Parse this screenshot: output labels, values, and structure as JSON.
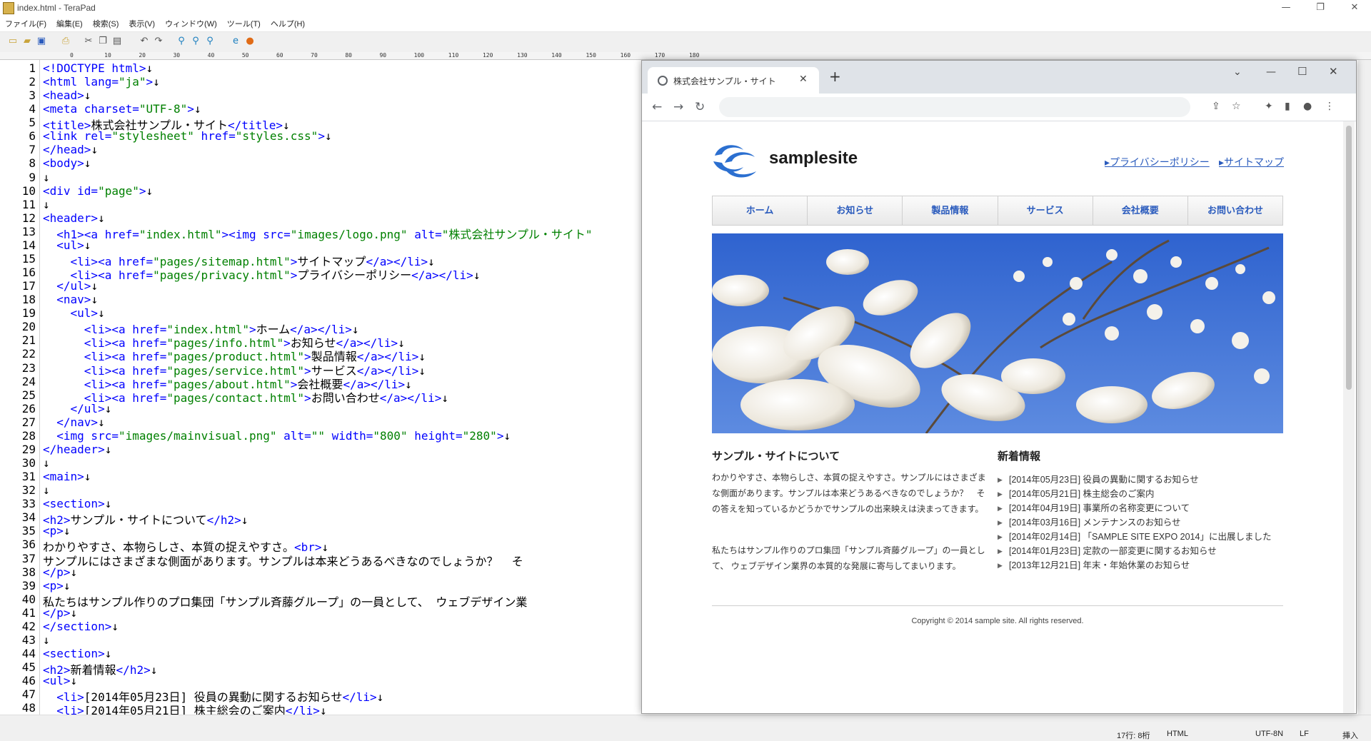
{
  "window": {
    "title": "index.html - TeraPad"
  },
  "menu": [
    "ファイル(F)",
    "編集(E)",
    "検索(S)",
    "表示(V)",
    "ウィンドウ(W)",
    "ツール(T)",
    "ヘルプ(H)"
  ],
  "ruler": {
    "marks": "0         10        20        30        40        50        60        70        80        90        100       110       120       130       140       150       160       170       180"
  },
  "editor": {
    "lines": [
      "<!DOCTYPE html>↓",
      "<html lang=\"ja\">↓",
      "<head>↓",
      "<meta charset=\"UTF-8\">↓",
      "<title>株式会社サンプル・サイト</title>↓",
      "<link rel=\"stylesheet\" href=\"styles.css\">↓",
      "</head>↓",
      "<body>↓",
      "↓",
      "<div id=\"page\">↓",
      "↓",
      "<header>↓",
      "  <h1><a href=\"index.html\"><img src=\"images/logo.png\" alt=\"株式会社サンプル・サイト\"",
      "  <ul>↓",
      "    <li><a href=\"pages/sitemap.html\">サイトマップ</a></li>↓",
      "    <li><a href=\"pages/privacy.html\">プライバシーポリシー</a></li>↓",
      "  </ul>↓",
      "  <nav>↓",
      "    <ul>↓",
      "      <li><a href=\"index.html\">ホーム</a></li>↓",
      "      <li><a href=\"pages/info.html\">お知らせ</a></li>↓",
      "      <li><a href=\"pages/product.html\">製品情報</a></li>↓",
      "      <li><a href=\"pages/service.html\">サービス</a></li>↓",
      "      <li><a href=\"pages/about.html\">会社概要</a></li>↓",
      "      <li><a href=\"pages/contact.html\">お問い合わせ</a></li>↓",
      "    </ul>↓",
      "  </nav>↓",
      "  <img src=\"images/mainvisual.png\" alt=\"\" width=\"800\" height=\"280\">↓",
      "</header>↓",
      "↓",
      "<main>↓",
      "↓",
      "<section>↓",
      "<h2>サンプル・サイトについて</h2>↓",
      "<p>↓",
      "わかりやすさ、本物らしさ、本質の捉えやすさ。<br>↓",
      "サンプルにはさまざまな側面があります。サンプルは本来どうあるべきなのでしょうか？  そ",
      "</p>↓",
      "<p>↓",
      "私たちはサンプル作りのプロ集団「サンプル斉藤グループ」の一員として、 ウェブデザイン業",
      "</p>↓",
      "</section>↓",
      "↓",
      "<section>↓",
      "<h2>新着情報</h2>↓",
      "<ul>↓",
      "  <li>[2014年05月23日] 役員の異動に関するお知らせ</li>↓",
      "  <li>[2014年05月21日] 株主総会のご案内</li>↓"
    ]
  },
  "status": {
    "position": "17行:  8桁",
    "mode": "HTML",
    "encoding": "UTF-8N",
    "linebreak": "LF",
    "insert": "挿入"
  },
  "browser": {
    "tab_title": "株式会社サンプル・サイト",
    "site": {
      "logo_text": "samplesite",
      "header_links": [
        "▸プライバシーポリシー",
        "▸サイトマップ"
      ],
      "nav": [
        "ホーム",
        "お知らせ",
        "製品情報",
        "サービス",
        "会社概要",
        "お問い合わせ"
      ],
      "about_title": "サンプル・サイトについて",
      "about_p1": "わかりやすさ、本物らしさ、本質の捉えやすさ。サンプルにはさまざまな側面があります。サンプルは本来どうあるべきなのでしょうか？　その答えを知っているかどうかでサンプルの出来映えは決まってきます。",
      "about_p2": "私たちはサンプル作りのプロ集団「サンプル斉藤グループ」の一員として、 ウェブデザイン業界の本質的な発展に寄与してまいります。",
      "news_title": "新着情報",
      "news": [
        "[2014年05月23日] 役員の異動に関するお知らせ",
        "[2014年05月21日] 株主総会のご案内",
        "[2014年04月19日] 事業所の名称変更について",
        "[2014年03月16日] メンテナンスのお知らせ",
        "[2014年02月14日] 「SAMPLE SITE EXPO 2014」に出展しました",
        "[2014年01月23日] 定款の一部変更に関するお知らせ",
        "[2013年12月21日] 年末・年始休業のお知らせ"
      ],
      "copyright": "Copyright © 2014 sample site. All rights reserved."
    }
  },
  "colors": {
    "tag": "#0000ff",
    "string": "#008000",
    "link": "#2a5bbd",
    "hero_sky": "#3b6fd4"
  }
}
